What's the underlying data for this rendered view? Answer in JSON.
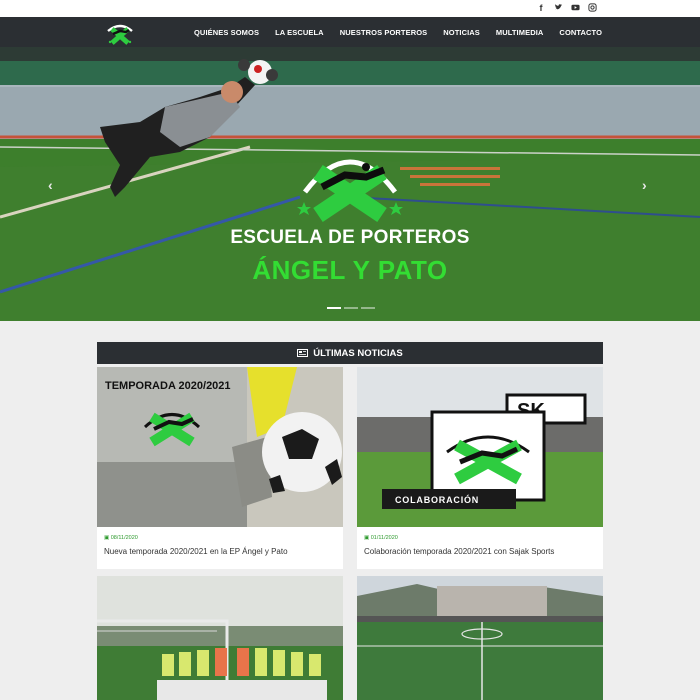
{
  "social": {
    "icons": [
      "facebook-icon",
      "twitter-icon",
      "youtube-icon",
      "instagram-icon"
    ]
  },
  "nav": {
    "items": [
      "QUIÉNES SOMOS",
      "LA ESCUELA",
      "NUESTROS PORTEROS",
      "NOTICIAS",
      "MULTIMEDIA",
      "CONTACTO"
    ]
  },
  "hero": {
    "title": "ESCUELA DE PORTEROS",
    "subtitle": "ÁNGEL Y PATO",
    "prev": "‹",
    "next": "›",
    "badge_text": "ESCUELA DE PORTEROS"
  },
  "news": {
    "heading": "ÚLTIMAS NOTICIAS",
    "cards": [
      {
        "date": "08/11/2020",
        "title": "Nueva temporada 2020/2021 en la EP Ángel y Pato",
        "image_heading": "TEMPORADA 2020/2021",
        "image_badge": "ESCUELA DE PORTERS"
      },
      {
        "date": "01/11/2020",
        "title": "Colaboración temporada 2020/2021 con Sajak Sports",
        "image_badge": "ESCUELA DE PORTERS",
        "image_label": "COLABORACIÓN",
        "image_logo": "SK"
      },
      {
        "date": "",
        "title": ""
      },
      {
        "date": "",
        "title": ""
      }
    ]
  },
  "colors": {
    "nav_bg": "#2b2f33",
    "accent_green": "#33dd33",
    "page_bg": "#eeeeee"
  }
}
